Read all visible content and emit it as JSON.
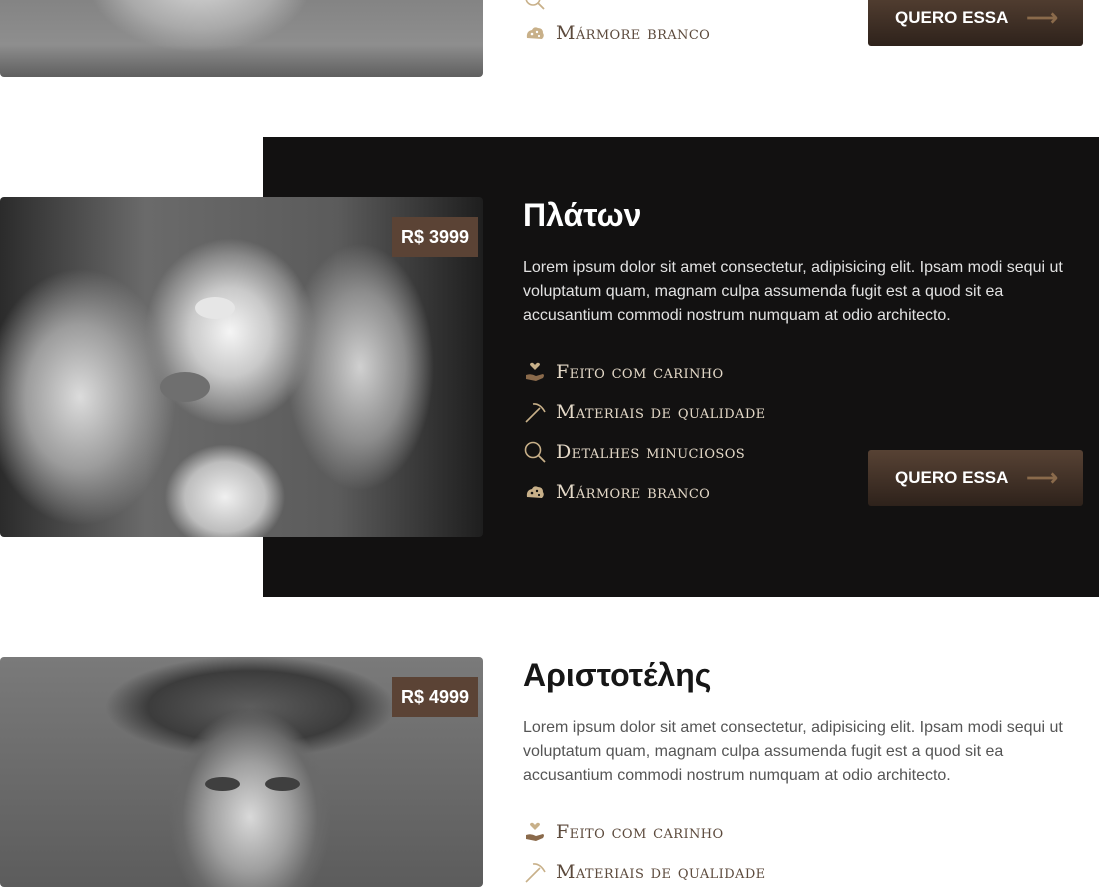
{
  "products": [
    {
      "feature_last": "Mármore branco",
      "button_label": "QUERO ESSA",
      "button_arrow": "⟶"
    },
    {
      "title": "Πλάτων",
      "price": "R$ 3999",
      "description": "Lorem ipsum dolor sit amet consectetur, adipisicing elit. Ipsam modi sequi ut voluptatum quam, magnam culpa assumenda fugit est a quod sit ea accusantium commodi nostrum numquam at odio architecto.",
      "features": [
        {
          "label": "Feito com carinho",
          "icon": "hand-heart-icon"
        },
        {
          "label": "Materiais de qualidade",
          "icon": "pickaxe-icon"
        },
        {
          "label": "Detalhes minuciosos",
          "icon": "magnifier-icon"
        },
        {
          "label": "Mármore branco",
          "icon": "marble-icon"
        }
      ],
      "button_label": "QUERO ESSA",
      "button_arrow": "⟶"
    },
    {
      "title": "Αριστοτέλης",
      "price": "R$ 4999",
      "description": "Lorem ipsum dolor sit amet consectetur, adipisicing elit. Ipsam modi sequi ut voluptatum quam, magnam culpa assumenda fugit est a quod sit ea accusantium commodi nostrum numquam at odio architecto.",
      "features": [
        {
          "label": "Feito com carinho",
          "icon": "hand-heart-icon"
        },
        {
          "label": "Materiais de qualidade",
          "icon": "pickaxe-icon"
        }
      ]
    }
  ],
  "colors": {
    "accent_brown": "#5b4335",
    "dark_band": "#121111",
    "feature_text_light": "#e3d8c7",
    "feature_icon": "#c8b089"
  }
}
